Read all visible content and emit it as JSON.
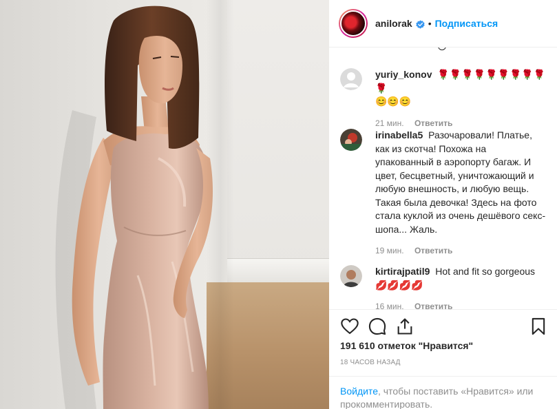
{
  "post": {
    "username": "anilorak",
    "follow_label": "Подписаться",
    "separator": "•"
  },
  "comments": [
    {
      "username": "yuriy_konov",
      "text": "",
      "emojis_line1": "🌹🌹🌹🌹🌹🌹🌹🌹🌹🌹",
      "emojis_line2": "😊😊😊",
      "time": "21 мин.",
      "reply_label": "Ответить"
    },
    {
      "username": "irinabella5",
      "text": "Разочаровали! Платье, как из скотча! Похожа на упакованный в аэропорту багаж. И цвет, бесцветный, уничтожающий и любую внешность, и любую вещь. Такая была девочка! Здесь на фото стала куклой из очень дешёвого секс-шопа... Жаль.",
      "time": "19 мин.",
      "reply_label": "Ответить"
    },
    {
      "username": "kirtirajpatil9",
      "text": "Hot and fit so gorgeous",
      "emojis_line2": "💋💋💋💋",
      "time": "16 мин.",
      "reply_label": "Ответить"
    }
  ],
  "stats": {
    "likes": "191 610 отметок \"Нравится\"",
    "time_ago": "18 ЧАСОВ НАЗАД"
  },
  "login_prompt": {
    "link": "Войдите",
    "text": ", чтобы поставить «Нравится» или прокомментировать."
  },
  "icons": {
    "like": "heart-icon",
    "comment": "comment-icon",
    "share": "share-icon",
    "save": "bookmark-icon"
  },
  "colors": {
    "link": "#0095f6",
    "muted": "#8e8e8e",
    "text": "#262626"
  }
}
